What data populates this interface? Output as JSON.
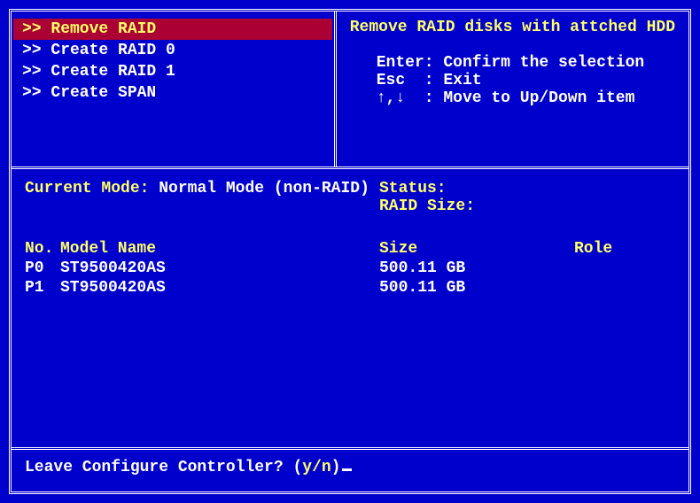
{
  "menu": {
    "items": [
      {
        "label": ">> Remove RAID",
        "selected": true
      },
      {
        "label": ">> Create RAID 0",
        "selected": false
      },
      {
        "label": ">> Create RAID 1",
        "selected": false
      },
      {
        "label": ">> Create SPAN",
        "selected": false
      }
    ]
  },
  "help": {
    "title": "Remove RAID disks with attched HDD",
    "lines": [
      "Enter: Confirm the selection",
      "Esc  : Exit",
      "↑,↓  : Move to Up/Down item"
    ]
  },
  "main": {
    "mode_label": "Current Mode:",
    "mode_value": " Normal Mode (non-RAID)",
    "status_label": "Status:",
    "status_value": "",
    "raid_size_label": "RAID Size:",
    "raid_size_value": "",
    "headers": {
      "no": "No.",
      "model": "Model Name",
      "size": "Size",
      "role": "Role"
    },
    "disks": [
      {
        "no": "P0",
        "model": "ST9500420AS",
        "size": "500.11 GB",
        "role": ""
      },
      {
        "no": "P1",
        "model": "ST9500420AS",
        "size": "500.11 GB",
        "role": ""
      }
    ]
  },
  "prompt": {
    "text_prefix": "Leave Configure Controller? (",
    "yn": "y/n",
    "text_suffix": ")"
  }
}
